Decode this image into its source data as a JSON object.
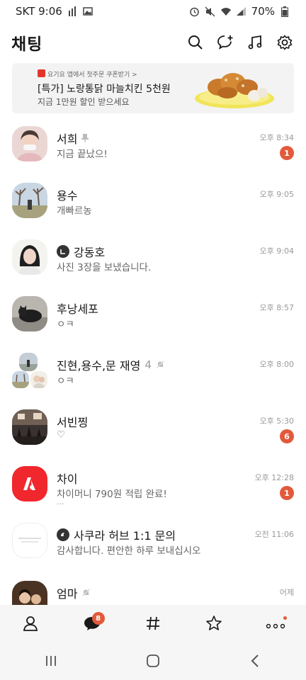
{
  "status_bar": {
    "carrier_time": "SKT 9:06",
    "battery": "70%"
  },
  "header": {
    "title": "채팅"
  },
  "ad": {
    "small_text": "요기요 앱에서 첫주문 쿠폰받기 >",
    "title": "[특가] 노랑통닭 마늘치킨 5천원",
    "subtitle": "지금 1만원 할인 받으세요"
  },
  "chats": [
    {
      "name": "서희",
      "preview": "지금 끝났으!",
      "time": "오후 8:34",
      "badge": "1"
    },
    {
      "name": "용수",
      "preview": "개빠르농",
      "time": "오후 9:05",
      "badge": ""
    },
    {
      "name": "강동호",
      "preview": "사진 3장을 보냈습니다.",
      "time": "오후 9:04",
      "badge": ""
    },
    {
      "name": "후낭세포",
      "preview": "ㅇㅋ",
      "time": "오후 8:57",
      "badge": ""
    },
    {
      "name": "진현,용수,문 재영",
      "count": "4",
      "preview": "ㅇㅋ",
      "time": "오후 8:00",
      "badge": ""
    },
    {
      "name": "서빈찡",
      "preview": "♡",
      "time": "오후 5:30",
      "badge": "6"
    },
    {
      "name": "차이",
      "preview": "차이머니 790원 적립 완료!",
      "preview2": "...",
      "time": "오후 12:28",
      "badge": "1"
    },
    {
      "name": "사쿠라 허브 1:1 문의",
      "preview": "감사합니다. 편안한 하루 보내십시오",
      "time": "오전 11:06",
      "badge": ""
    },
    {
      "name": "엄마",
      "preview": "",
      "time": "어제",
      "badge": ""
    }
  ],
  "bottom_nav": {
    "chat_badge": "8"
  },
  "colors": {
    "badge": "#e25a3b",
    "chai_red": "#f0272d"
  }
}
